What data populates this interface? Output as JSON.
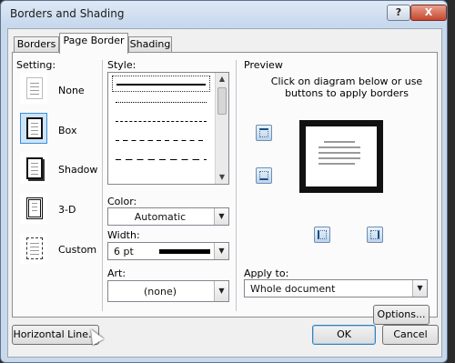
{
  "window": {
    "title": "Borders and Shading",
    "help_label": "?",
    "close_label": "X"
  },
  "tabs": [
    {
      "label": "Borders"
    },
    {
      "label": "Page Border"
    },
    {
      "label": "Shading"
    }
  ],
  "setting": {
    "heading": "Setting:",
    "items": [
      {
        "label": "None",
        "icon": "page-none-icon"
      },
      {
        "label": "Box",
        "icon": "page-box-icon"
      },
      {
        "label": "Shadow",
        "icon": "page-shadow-icon"
      },
      {
        "label": "3-D",
        "icon": "page-3d-icon"
      },
      {
        "label": "Custom",
        "icon": "page-custom-icon"
      }
    ],
    "selected": "Box"
  },
  "style": {
    "heading": "Style:"
  },
  "color": {
    "label": "Color:",
    "value": "Automatic"
  },
  "width": {
    "label": "Width:",
    "value": "6 pt"
  },
  "art": {
    "label": "Art:",
    "value": "(none)"
  },
  "preview": {
    "heading": "Preview",
    "hint": "Click on diagram below or use buttons to apply borders"
  },
  "apply_to": {
    "label": "Apply to:",
    "value": "Whole document"
  },
  "buttons": {
    "options": "Options...",
    "horizontal_line": "Horizontal Line...",
    "ok": "OK",
    "cancel": "Cancel"
  }
}
